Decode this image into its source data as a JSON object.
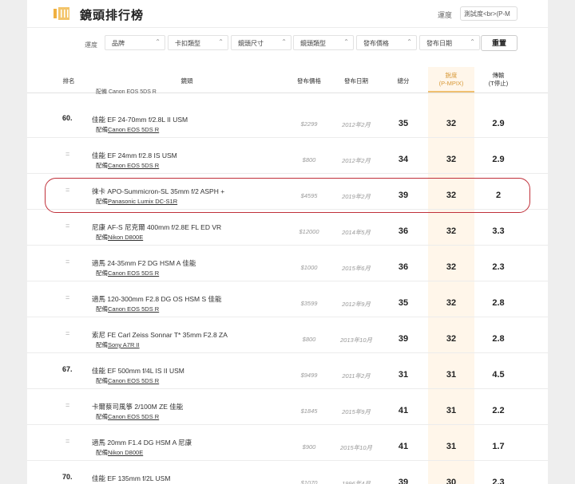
{
  "header": {
    "title": "鏡頭排行榜",
    "sort_label": "運度",
    "sort_value": "測試度<br>(P-M"
  },
  "filters": {
    "label": "運度",
    "items": [
      "品牌",
      "卡扣類型",
      "鏡頭尺寸",
      "鏡頭類型",
      "發布價格",
      "發布日期"
    ],
    "reset": "重置"
  },
  "columns": {
    "rank": "排名",
    "lens": "鏡頭",
    "price": "發布價格",
    "date": "發布日期",
    "score": "總分",
    "resolution_line1": "銳度",
    "resolution_line2": "(P-MPIX)",
    "stops_line1": "傳輸",
    "stops_line2": "(T停止)"
  },
  "top_partial": "配備 Canon EOS 5DS R",
  "paired_prefix": "配備",
  "rows": [
    {
      "rank": "60.",
      "lens": "佳能 EF 24-70mm f/2.8L II USM",
      "camera": "Canon EOS 5DS R",
      "price": "$2299",
      "date": "2012年2月",
      "score": "35",
      "resolution": "32",
      "stops": "2.9"
    },
    {
      "rank": "=",
      "lens": "佳能 EF 24mm f/2.8 IS USM",
      "camera": "Canon EOS 5DS R",
      "price": "$800",
      "date": "2012年2月",
      "score": "34",
      "resolution": "32",
      "stops": "2.9"
    },
    {
      "rank": "=",
      "lens": "徠卡 APO-Summicron-SL 35mm f/2 ASPH +",
      "camera": "Panasonic Lumix DC-S1R",
      "price": "$4595",
      "date": "2019年2月",
      "score": "39",
      "resolution": "32",
      "stops": "2"
    },
    {
      "rank": "=",
      "lens": "尼康 AF-S 尼克爾 400mm f/2.8E FL ED VR",
      "camera": "Nikon D800E",
      "price": "$12000",
      "date": "2014年5月",
      "score": "36",
      "resolution": "32",
      "stops": "3.3"
    },
    {
      "rank": "=",
      "lens": "適馬 24-35mm F2 DG HSM A 佳能",
      "camera": "Canon EOS 5DS R",
      "price": "$1000",
      "date": "2015年6月",
      "score": "36",
      "resolution": "32",
      "stops": "2.3"
    },
    {
      "rank": "=",
      "lens": "適馬 120-300mm F2.8 DG OS HSM S 佳能",
      "camera": "Canon EOS 5DS R",
      "price": "$3599",
      "date": "2012年9月",
      "score": "35",
      "resolution": "32",
      "stops": "2.8"
    },
    {
      "rank": "=",
      "lens": "索尼 FE Carl Zeiss Sonnar T* 35mm F2.8 ZA",
      "camera": "Sony A7R II",
      "price": "$800",
      "date": "2013年10月",
      "score": "39",
      "resolution": "32",
      "stops": "2.8"
    },
    {
      "rank": "67.",
      "lens": "佳能 EF 500mm f/4L IS II USM",
      "camera": "Canon EOS 5DS R",
      "price": "$9499",
      "date": "2011年2月",
      "score": "31",
      "resolution": "31",
      "stops": "4.5"
    },
    {
      "rank": "=",
      "lens": "卡爾蔡司風箏 2/100M ZE 佳能",
      "camera": "Canon EOS 5DS R",
      "price": "$1845",
      "date": "2015年9月",
      "score": "41",
      "resolution": "31",
      "stops": "2.2"
    },
    {
      "rank": "=",
      "lens": "適馬 20mm F1.4 DG HSM A 尼康",
      "camera": "Nikon D800E",
      "price": "$900",
      "date": "2015年10月",
      "score": "41",
      "resolution": "31",
      "stops": "1.7"
    },
    {
      "rank": "70.",
      "lens": "佳能 EF 135mm f/2L USM",
      "camera": "",
      "price": "$1070",
      "date": "1996年4月",
      "score": "39",
      "resolution": "30",
      "stops": "2.3"
    }
  ]
}
